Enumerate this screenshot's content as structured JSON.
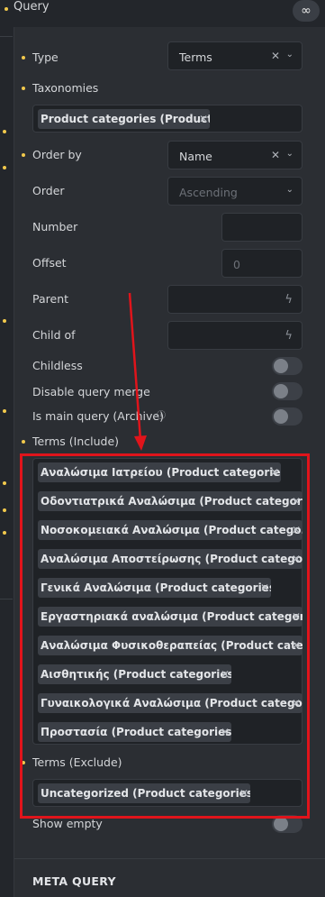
{
  "header": {
    "title": "Query",
    "loop_icon": "infinity-icon"
  },
  "fields": {
    "type": {
      "label": "Type",
      "value": "Terms"
    },
    "taxonomies": {
      "label": "Taxonomies",
      "tag": "Product categories (Product)"
    },
    "order_by": {
      "label": "Order by",
      "value": "Name"
    },
    "order": {
      "label": "Order",
      "value": "Ascending"
    },
    "number": {
      "label": "Number",
      "value": ""
    },
    "offset": {
      "label": "Offset",
      "placeholder": "0"
    },
    "parent": {
      "label": "Parent"
    },
    "child_of": {
      "label": "Child of"
    },
    "childless": {
      "label": "Childless"
    },
    "disable_query_merge": {
      "label": "Disable query merge"
    },
    "is_main_query": {
      "label": "Is main query (Archive)"
    },
    "terms_include": {
      "label": "Terms (Include)",
      "tags": [
        "Αναλώσιμα Ιατρείου (Product categories)",
        "Οδοντιατρικά Αναλώσιμα (Product categori...",
        "Νοσοκομειακά Αναλώσιμα (Product catego...",
        "Αναλώσιμα Αποστείρωσης (Product catego...",
        "Γενικά Αναλώσιμα (Product categories)",
        "Εργαστηριακά αναλώσιμα (Product categor...",
        "Αναλώσιμα Φυσικοθεραπείας (Product cate...",
        "Αισθητικής (Product categories)",
        "Γυναικολογικά Αναλώσιμα (Product catego...",
        "Προστασία (Product categories)"
      ]
    },
    "terms_exclude": {
      "label": "Terms (Exclude)",
      "tags": [
        "Uncategorized (Product categories)"
      ]
    },
    "show_empty": {
      "label": "Show empty"
    }
  },
  "meta_query": {
    "title": "META QUERY"
  },
  "annotation": {
    "highlight_color": "#e0141b",
    "accent_dot_color": "#f2c94c"
  }
}
